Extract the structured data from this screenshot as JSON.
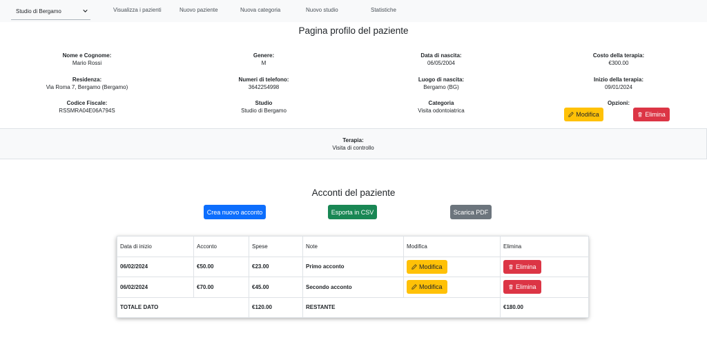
{
  "navbar": {
    "studio_selected": "Studio di Bergamo",
    "links": [
      "Visualizza i pazienti",
      "Nuovo paziente",
      "Nuova categoria",
      "Nuovo studio",
      "Statistiche"
    ]
  },
  "page_title": "Pagina profilo del paziente",
  "patient": {
    "name_label": "Nome e Cognome:",
    "name": "Mario Rossi",
    "gender_label": "Genere:",
    "gender": "M",
    "birthdate_label": "Data di nascita:",
    "birthdate": "06/05/2004",
    "cost_label": "Costo della terapia:",
    "cost": "€300.00",
    "residence_label": "Residenza:",
    "residence": "Via Roma 7, Bergamo (Bergamo)",
    "phone_label": "Numeri di telefono:",
    "phone": "3642254998",
    "birthplace_label": "Luogo di nascita:",
    "birthplace": "Bergamo (BG)",
    "start_label": "Inizio della terapia:",
    "start": "09/01/2024",
    "fiscal_label": "Codice Fiscale:",
    "fiscal": "RSSMRA04E06A794S",
    "studio_label": "Studio",
    "studio": "Studio di Bergamo",
    "category_label": "Categoria",
    "category": "Visita odontoiatrica",
    "options_label": "Opzioni:",
    "edit_label": "Modifica",
    "delete_label": "Elimina"
  },
  "therapy": {
    "label": "Terapia:",
    "value": "Visita di controllo"
  },
  "accounts": {
    "title": "Acconti del paziente",
    "new_button": "Crea nuovo acconto",
    "csv_button": "Esporta in CSV",
    "pdf_button": "Scarica PDF",
    "headers": [
      "Data di inizio",
      "Acconto",
      "Spese",
      "Note",
      "Modifica",
      "Elimina"
    ],
    "rows": [
      {
        "date": "06/02/2024",
        "amount": "€50.00",
        "expenses": "€23.00",
        "note": "Primo acconto",
        "edit": "Modifica",
        "delete": "Elimina"
      },
      {
        "date": "06/02/2024",
        "amount": "€70.00",
        "expenses": "€45.00",
        "note": "Secondo acconto",
        "edit": "Modifica",
        "delete": "Elimina"
      }
    ],
    "total_label": "TOTALE DATO",
    "total_expenses": "€120.00",
    "remaining_label": "RESTANTE",
    "remaining_value": "€180.00"
  },
  "colors": {
    "warning": "#ffc107",
    "danger": "#dc3545",
    "primary": "#0d6efd",
    "success": "#198754",
    "secondary": "#6c757d"
  },
  "icons": {
    "edit": "pencil-icon",
    "delete": "trash-icon",
    "dropdown": "chevron-down-icon"
  }
}
